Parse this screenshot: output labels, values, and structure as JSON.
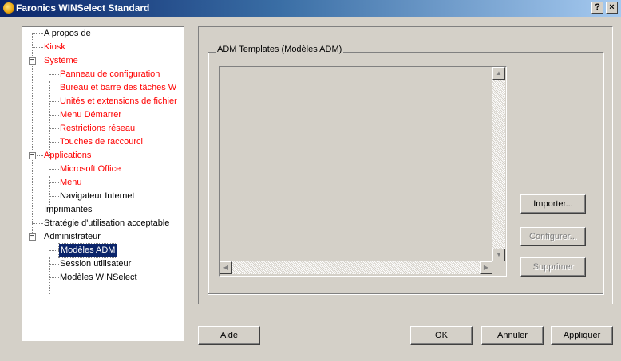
{
  "window": {
    "title": "Faronics WINSelect Standard",
    "help_button": "?",
    "close_button": "×"
  },
  "tree": {
    "items": [
      {
        "label": "A propos de",
        "color": "#000000"
      },
      {
        "label": "Kiosk",
        "color": "#ff0000"
      },
      {
        "label": "Système",
        "color": "#ff0000"
      },
      {
        "label": "Panneau de configuration",
        "color": "#ff0000"
      },
      {
        "label": "Bureau et barre des tâches W",
        "color": "#ff0000"
      },
      {
        "label": "Unités et extensions de fichier",
        "color": "#ff0000"
      },
      {
        "label": "Menu Démarrer",
        "color": "#ff0000"
      },
      {
        "label": "Restrictions réseau",
        "color": "#ff0000"
      },
      {
        "label": "Touches de raccourci",
        "color": "#ff0000"
      },
      {
        "label": "Applications",
        "color": "#ff0000"
      },
      {
        "label": "Microsoft Office",
        "color": "#ff0000"
      },
      {
        "label": "Menu",
        "color": "#ff0000"
      },
      {
        "label": "Navigateur Internet",
        "color": "#000000"
      },
      {
        "label": "Imprimantes",
        "color": "#000000"
      },
      {
        "label": "Stratégie d'utilisation acceptable",
        "color": "#000000"
      },
      {
        "label": "Administrateur",
        "color": "#000000"
      },
      {
        "label": "Modèles ADM",
        "color": "#000000",
        "selected": true
      },
      {
        "label": "Session utilisateur",
        "color": "#000000"
      },
      {
        "label": "Modèles WINSelect",
        "color": "#000000"
      }
    ],
    "expander_symbol": "−"
  },
  "adm": {
    "group_title": "ADM Templates (Modèles ADM)",
    "buttons": {
      "import": "Importer...",
      "configure": "Configurer...",
      "delete": "Supprimer"
    }
  },
  "footer": {
    "help": "Aide",
    "ok": "OK",
    "cancel": "Annuler",
    "apply": "Appliquer"
  },
  "colors": {
    "title_bar": "#0a246a",
    "window_bg": "#d4d0c8",
    "accent_red": "#ff0000",
    "selection": "#0a246a"
  }
}
